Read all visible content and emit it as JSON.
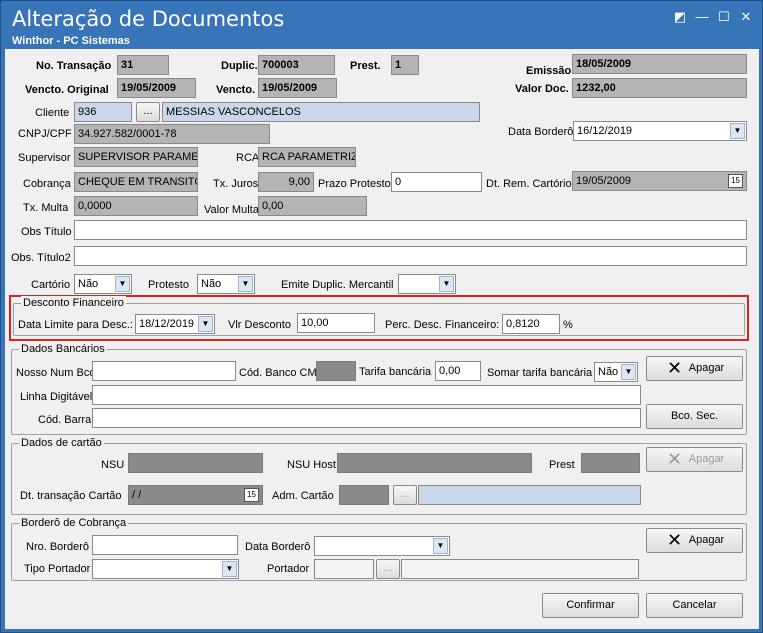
{
  "window": {
    "title": "Alteração de Documentos",
    "subtitle": "Winthor - PC Sistemas"
  },
  "header": {
    "no_transacao_label": "No. Transação",
    "no_transacao": "31",
    "duplic_label": "Duplic.",
    "duplic": "700003",
    "prest_label": "Prest.",
    "prest": "1",
    "emissao_label": "Emissão",
    "emissao": "18/05/2009",
    "vencto_original_label": "Vencto. Original",
    "vencto_original": "19/05/2009",
    "vencto_label": "Vencto.",
    "vencto": "19/05/2009",
    "valor_doc_label": "Valor Doc.",
    "valor_doc": "1232,00"
  },
  "form": {
    "cliente_label": "Cliente",
    "cliente_cod": "936",
    "cliente_btn": "...",
    "cliente_nome": "MESSIAS VASCONCELOS",
    "cnpj_label": "CNPJ/CPF",
    "cnpj": "34.927.582/0001-78",
    "data_bordero_label": "Data Borderô",
    "data_bordero": "16/12/2019",
    "supervisor_label": "Supervisor",
    "supervisor": "SUPERVISOR PARAMETR",
    "rca_label": "RCA",
    "rca": "RCA PARAMETRIZA",
    "cobranca_label": "Cobrança",
    "cobranca": "CHEQUE EM TRANSITO",
    "tx_juros_label": "Tx. Juros",
    "tx_juros": "9,00",
    "prazo_protesto_label": "Prazo Protesto",
    "prazo_protesto": "0",
    "dt_rem_cartorio_label": "Dt. Rem. Cartório",
    "dt_rem_cartorio": "19/05/2009",
    "tx_multa_label": "Tx. Multa",
    "tx_multa": "0,0000",
    "valor_multa_label": "Valor Multa",
    "valor_multa": "0,00",
    "obs_titulo_label": "Obs Título",
    "obs_titulo": "",
    "obs_titulo2_label": "Obs. Título2",
    "obs_titulo2": "",
    "cartorio_label": "Cartório",
    "cartorio": "Não",
    "protesto_label": "Protesto",
    "protesto": "Não",
    "emite_duplic_label": "Emite Duplic. Mercantil",
    "emite_duplic": ""
  },
  "desconto": {
    "group_label": "Desconto Financeiro",
    "data_limite_label": "Data Limite para Desc.:",
    "data_limite": "18/12/2019",
    "vlr_desconto_label": "Vlr Desconto",
    "vlr_desconto": "10,00",
    "perc_label": "Perc. Desc. Financeiro:",
    "perc": "0,8120",
    "perc_unit": "%",
    "highlight_color": "#e02020"
  },
  "bancarios": {
    "group_label": "Dados Bancários",
    "nosso_num_label": "Nosso Num Bco",
    "nosso_num": "",
    "cod_banco_label": "Cód. Banco CM",
    "cod_banco": "",
    "tarifa_label": "Tarifa bancária",
    "tarifa": "0,00",
    "somar_tarifa_label": "Somar tarifa bancária",
    "somar_tarifa": "Não",
    "apagar_label": "Apagar",
    "linha_digitavel_label": "Linha Digitável",
    "linha_digitavel": "",
    "cod_barra_label": "Cód. Barra",
    "cod_barra": "",
    "bco_sec_label": "Bco. Sec."
  },
  "cartao": {
    "group_label": "Dados de cartão",
    "nsu_label": "NSU",
    "nsu_host_label": "NSU Host",
    "prest_label": "Prest",
    "apagar_label": "Apagar",
    "dt_transacao_label": "Dt. transação Cartão",
    "dt_transacao": " / /",
    "adm_cartao_label": "Adm. Cartão",
    "adm_btn": "..."
  },
  "bordero_cobranca": {
    "group_label": "Borderô de Cobrança",
    "apagar_label": "Apagar",
    "nro_bordero_label": "Nro. Borderô",
    "nro_bordero": "",
    "data_bordero_label": "Data Borderô",
    "data_bordero": "",
    "tipo_portador_label": "Tipo Portador",
    "tipo_portador": "",
    "portador_label": "Portador",
    "portador_btn": "..."
  },
  "footer": {
    "confirmar_label": "Confirmar",
    "cancelar_label": "Cancelar"
  }
}
